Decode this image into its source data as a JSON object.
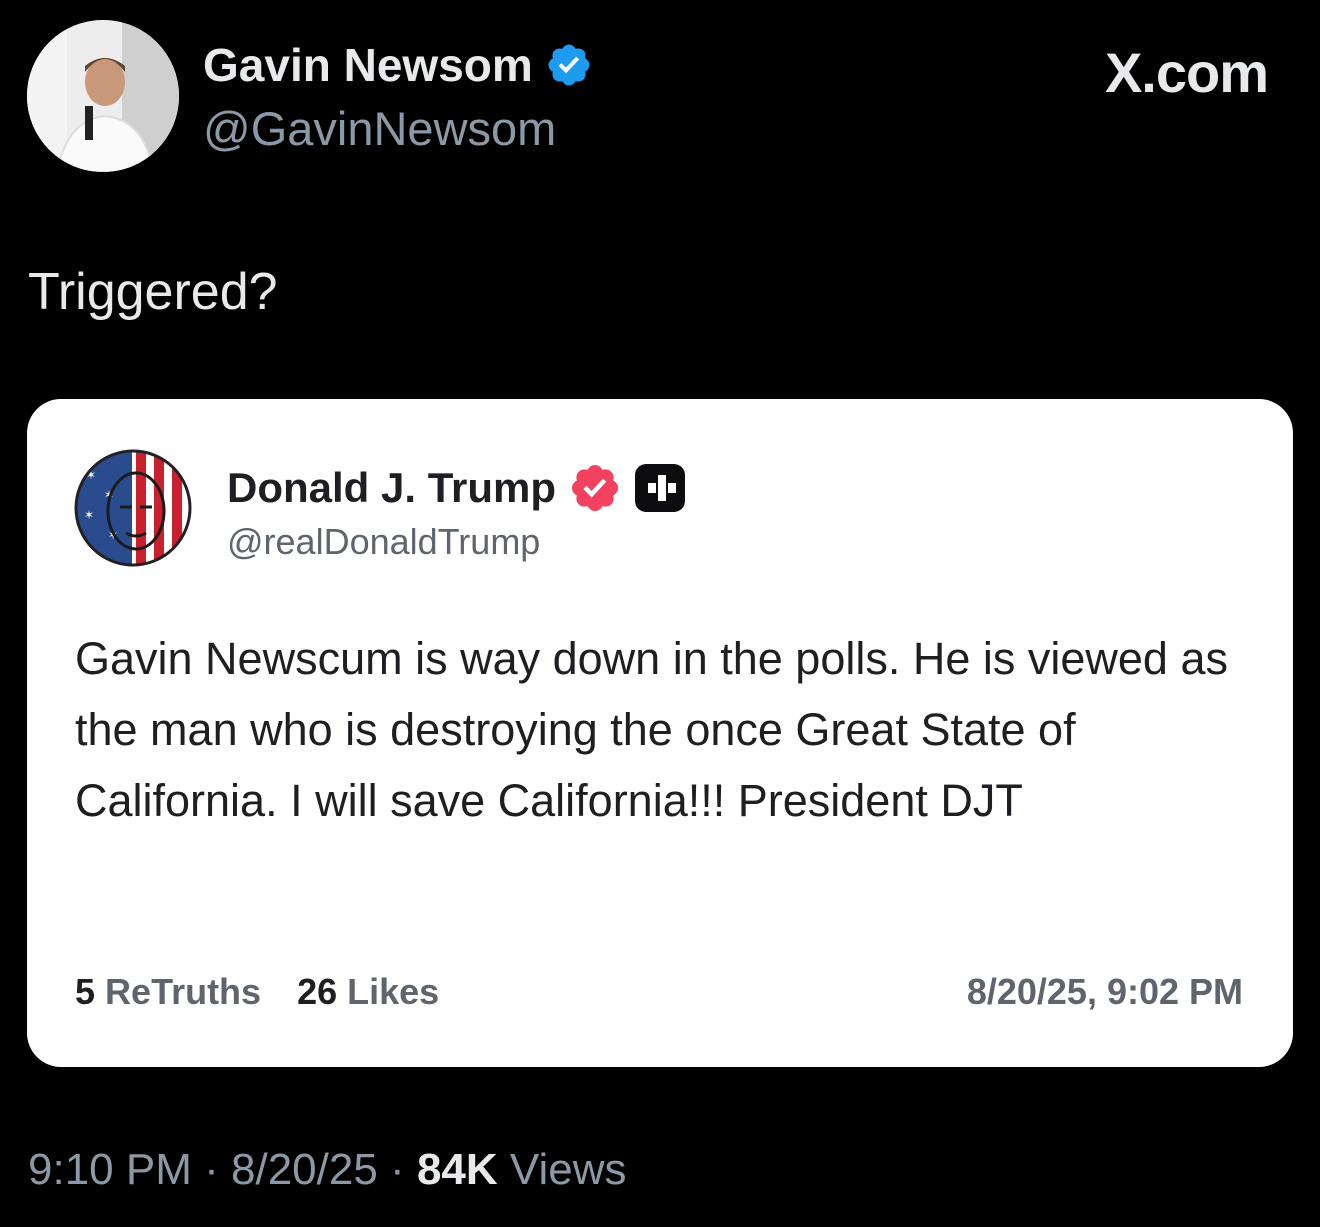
{
  "header": {
    "author_name": "Gavin Newsom",
    "author_handle": "@GavinNewsom",
    "brand": "X.com",
    "verified_color": "#1d9bf0"
  },
  "tweet": {
    "text": "Triggered?"
  },
  "quoted_post": {
    "author_name": "Donald J. Trump",
    "author_handle": "@realDonaldTrump",
    "body": "Gavin Newscum is way down in the polls. He is viewed as the man who is destroying the once Great State of California. I will save California!!! President DJT",
    "retruths_count": "5",
    "retruths_label": "ReTruths",
    "likes_count": "26",
    "likes_label": "Likes",
    "timestamp": "8/20/25, 9:02 PM",
    "badge_color": "#f2425f"
  },
  "footer": {
    "time": "9:10 PM",
    "separator": "·",
    "date": "8/20/25",
    "views_count": "84K",
    "views_label": "Views"
  }
}
